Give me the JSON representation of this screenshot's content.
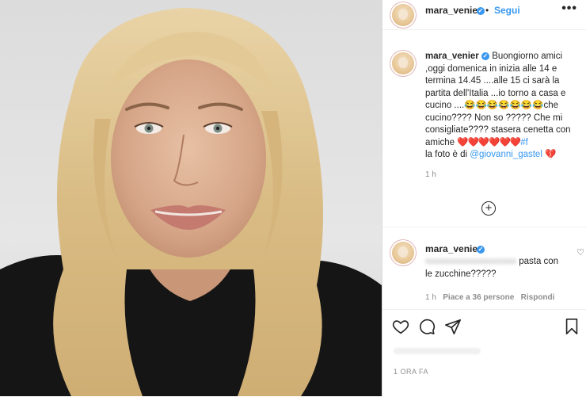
{
  "post": {
    "username": "mara_venier",
    "follow_label": "Segui",
    "more_label": "•••",
    "photo_alt": "",
    "caption_text": "Buongiorno amici ,oggi domenica in inizia alle 14 e termina 14.45 ....alle 15 ci sarà la partita dell'Italia ...io torno a casa e cucino ....",
    "caption_emojis": "😂😂😂😂😂😂😂",
    "caption_text_2": "che cucino???? Non so ????? Che mi consigliate???? stasera cenetta con amiche",
    "caption_hearts": "❤️❤️❤️❤️❤️❤️",
    "caption_hashtag": "#f",
    "caption_photo_credit_prefix": "la foto è di",
    "caption_mention": "@giovanni_gastel",
    "caption_broken_heart": "💔",
    "caption_time": "1 h"
  },
  "comment": {
    "username": "mara_venier",
    "text_hidden": "xxxxxxxxxxxxxxxxxxxx",
    "text_visible": "pasta con le zucchine?????",
    "time": "1 h",
    "likes": "Piace a 36 persone",
    "reply_label": "Rispondi"
  },
  "footer": {
    "timestamp": "1 ORA FA"
  },
  "icons": {
    "like": "heart-icon",
    "comment": "comment-icon",
    "share": "share-icon",
    "save": "bookmark-icon",
    "load_more": "plus-circle-icon",
    "verified": "verified-badge-icon"
  },
  "colors": {
    "accent": "#3897f0",
    "text": "#262626",
    "muted": "#8e8e8e",
    "heart": "#e0245e"
  }
}
